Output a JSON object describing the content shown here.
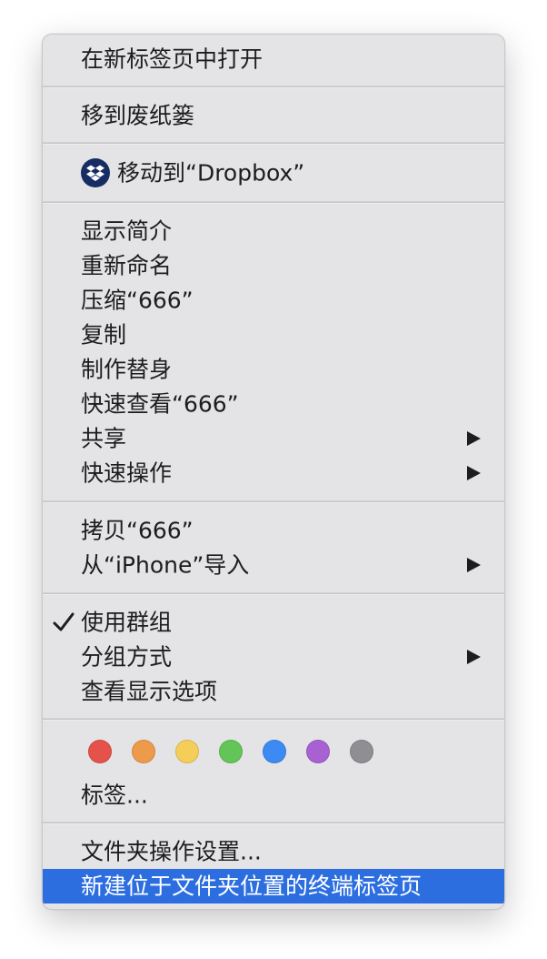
{
  "menu": {
    "open_new_tab": "在新标签页中打开",
    "move_to_trash": "移到废纸篓",
    "move_to_dropbox": "移动到“Dropbox”",
    "get_info": "显示简介",
    "rename": "重新命名",
    "compress": "压缩“666”",
    "duplicate": "复制",
    "make_alias": "制作替身",
    "quick_look": "快速查看“666”",
    "share": "共享",
    "quick_actions": "快速操作",
    "copy": "拷贝“666”",
    "import_from_iphone": "从“iPhone”导入",
    "use_groups": "使用群组",
    "group_by": "分组方式",
    "show_view_options": "查看显示选项",
    "tags": "标签...",
    "folder_actions_setup": "文件夹操作设置...",
    "new_terminal_tab": "新建位于文件夹位置的终端标签页"
  },
  "tag_colors": [
    "#e5514b",
    "#ed9a4a",
    "#f4ce59",
    "#63c557",
    "#3d8af4",
    "#a861d2",
    "#8e8e93"
  ],
  "selection_color": "#2c6ee0",
  "icons": {
    "dropbox": "dropbox-icon",
    "check": "checkmark-icon",
    "submenu": "chevron-right-icon"
  }
}
